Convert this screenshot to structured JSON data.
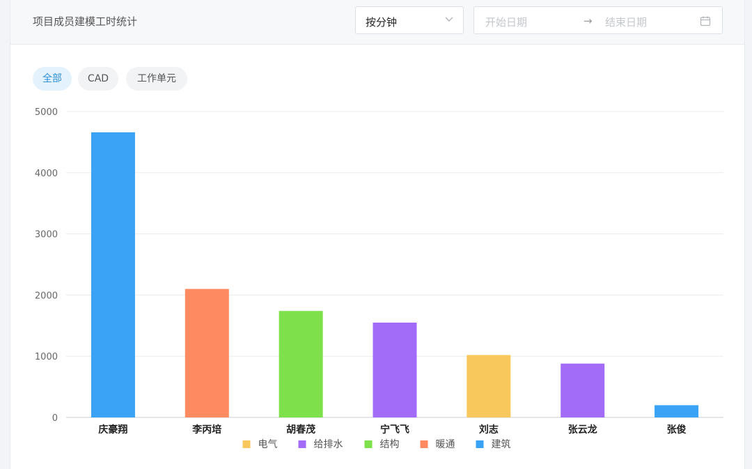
{
  "header": {
    "title": "项目成员建模工时统计",
    "unit_select": "按分钟",
    "date_range": {
      "start_placeholder": "开始日期",
      "separator": "→",
      "end_placeholder": "结束日期"
    }
  },
  "tabs": [
    {
      "label": "全部",
      "active": true
    },
    {
      "label": "CAD",
      "active": false
    },
    {
      "label": "工作单元",
      "active": false
    }
  ],
  "colors": {
    "电气": "#f9c85c",
    "给排水": "#a26cf8",
    "结构": "#7ee04a",
    "暖通": "#fd8a61",
    "建筑": "#3ba3f5"
  },
  "chart_data": {
    "type": "bar",
    "categories": [
      "庆豪翔",
      "李丙培",
      "胡春茂",
      "宁飞飞",
      "刘志",
      "张云龙",
      "张俊"
    ],
    "values": [
      4660,
      2100,
      1740,
      1550,
      1020,
      880,
      200
    ],
    "bar_series": [
      "建筑",
      "暖通",
      "结构",
      "给排水",
      "电气",
      "给排水",
      "建筑"
    ],
    "legend": [
      "电气",
      "给排水",
      "结构",
      "暖通",
      "建筑"
    ],
    "legend_position": "bottom-center",
    "ylim": [
      0,
      5000
    ],
    "yticks": [
      0,
      1000,
      2000,
      3000,
      4000,
      5000
    ],
    "grid": true
  }
}
